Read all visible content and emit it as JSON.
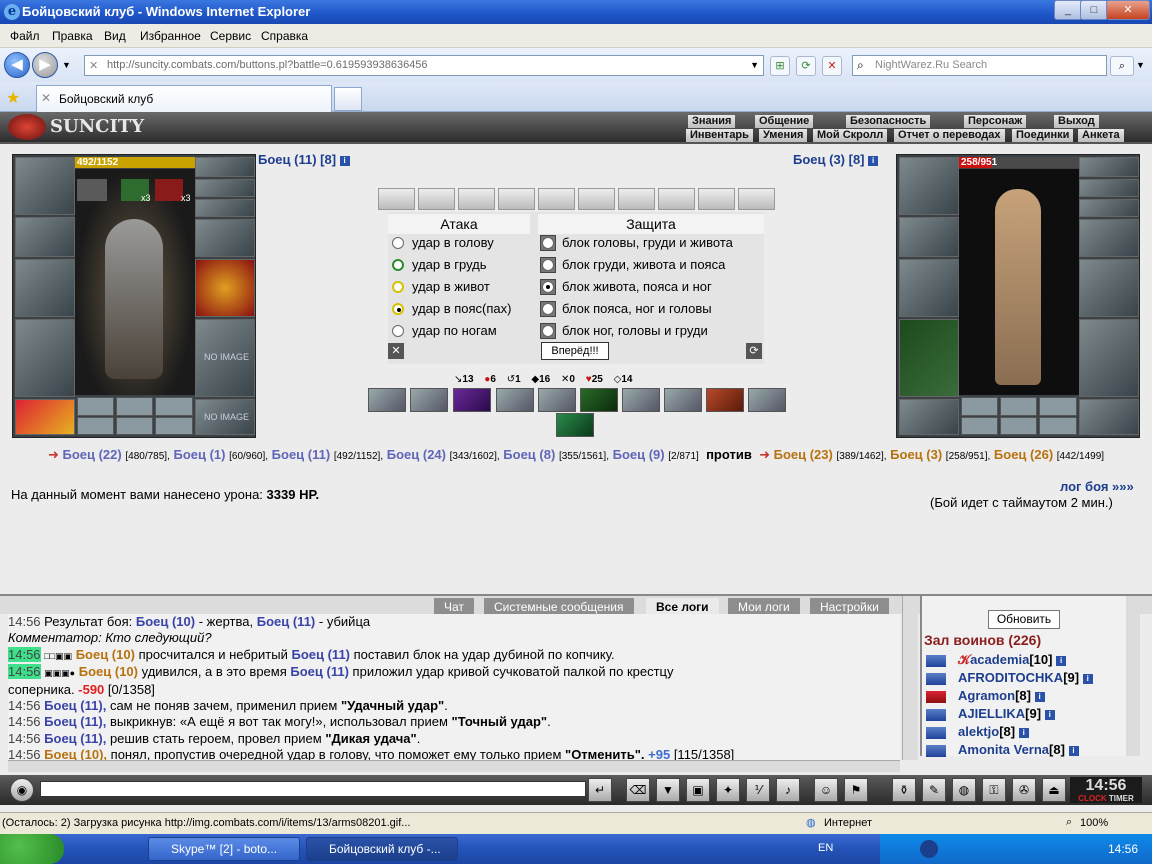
{
  "window": {
    "title": "Бойцовский клуб - Windows Internet Explorer"
  },
  "menu": [
    "Файл",
    "Правка",
    "Вид",
    "Избранное",
    "Сервис",
    "Справка"
  ],
  "address": {
    "url": "http://suncity.combats.com/buttons.pl?battle=0.619593938636456"
  },
  "search": {
    "placeholder": "NightWarez.Ru Search"
  },
  "tab": {
    "label": "Бойцовский клуб"
  },
  "game_nav": {
    "top": [
      "Знания",
      "Общение",
      "Безопасность",
      "Персонаж",
      "Выход"
    ],
    "bottom": [
      "Инвентарь",
      "Умения",
      "Мой Скролл",
      "Отчет о переводах",
      "Поединки",
      "Анкета"
    ]
  },
  "logo": "SUNCITY",
  "left_fighter": {
    "name": "Боец (11) [8]",
    "hp": "492/1152",
    "noimage1": "NO IMAGE",
    "noimage2": "NO IMAGE",
    "x3a": "x3",
    "x3b": "x3"
  },
  "right_fighter": {
    "name": "Боец (3) [8]",
    "hp": "258/951"
  },
  "attack": {
    "title": "Атака",
    "options": [
      "удар в голову",
      "удар в грудь",
      "удар в живот",
      "удар в пояс(пах)",
      "удар по ногам"
    ],
    "selected": 3
  },
  "defense": {
    "title": "Защита",
    "options": [
      "блок головы, груди и живота",
      "блок груди, живота и пояса",
      "блок живота, пояса и ног",
      "блок пояса, ног и головы",
      "блок ног, головы и груди"
    ],
    "selected": 2
  },
  "go_button": "Вперёд!!!",
  "stats": [
    "13",
    "6",
    "1",
    "16",
    "0",
    "25",
    "14"
  ],
  "teams": {
    "t1": [
      "Боец (22)",
      "Боец (1)",
      "Боец (11)",
      "Боец (24)",
      "Боец (8)",
      "Боец (9)"
    ],
    "t1hp": [
      "[480/785],",
      "[60/960],",
      "[492/1152],",
      "[343/1602],",
      "[355/1561],",
      "[2/871]"
    ],
    "vs": "против",
    "t2": [
      "Боец (23)",
      "Боец (3)",
      "Боец (26)"
    ],
    "t2hp": [
      "[389/1462],",
      "[258/951],",
      "[442/1499]"
    ]
  },
  "damage": {
    "label": "На данный момент вами нанесено урона:",
    "value": "3339 HP."
  },
  "battle_log_link": "лог боя »»»",
  "timeout": "(Бой идет с таймаутом 2 мин.)",
  "chat_tabs": [
    "Чат",
    "Системные сообщения",
    "Все логи",
    "Мои логи",
    "Настройки"
  ],
  "refresh": "Обновить",
  "hall": "Зал воинов (226)",
  "users": [
    {
      "name": "academia",
      "level": "[10]"
    },
    {
      "name": "AFRODITOCHKA",
      "level": "[9]"
    },
    {
      "name": "Agramon",
      "level": "[8]"
    },
    {
      "name": "AJIELLIKA",
      "level": "[9]"
    },
    {
      "name": "alektjo",
      "level": "[8]"
    },
    {
      "name": "Amonita Verna",
      "level": "[8]"
    }
  ],
  "log": {
    "l1": {
      "t": "14:56",
      "a": "Результат боя:",
      "p1": "Боец (10)",
      "b": "- жертва,",
      "p2": "Боец (11)",
      "c": "- убийца"
    },
    "l2": "Комментатор: Кто следующий?",
    "l3": {
      "t": "14:56",
      "p1": "Боец (10)",
      "a": "просчитался и небритый",
      "p2": "Боец (11)",
      "b": "поставил блок на удар дубиной по копчику."
    },
    "l4": {
      "t": "14:56",
      "p1": "Боец (10)",
      "a": "удивился, а в это время",
      "p2": "Боец (11)",
      "b": "приложил удар кривой сучковатой палкой по крестцу"
    },
    "l5": {
      "a": "соперника.",
      "dmg": "-590",
      "hp": "[0/1358]"
    },
    "l6": {
      "t": "14:56",
      "p": "Боец (11),",
      "a": "сам не поняв зачем, применил прием",
      "q": "\"Удачный удар\""
    },
    "l7": {
      "t": "14:56",
      "p": "Боец (11),",
      "a": "выкрикнув: «А ещё я вот так могу!», использовал прием",
      "q": "\"Точный удар\""
    },
    "l8": {
      "t": "14:56",
      "p": "Боец (11),",
      "a": "решив стать героем, провел прием",
      "q": "\"Дикая удача\""
    },
    "l9": {
      "t": "14:56",
      "p": "Боец (10),",
      "a": "понял, пропустив очередной удар в голову, что поможет ему только прием",
      "q": "\"Отменить\".",
      "plus": "+95",
      "hp": "[115/1358]"
    }
  },
  "clock": {
    "time": "14:56",
    "clock": "CLOCK",
    "timer": "TIMER"
  },
  "status": {
    "text": "(Осталось: 2) Загрузка рисунка http://img.combats.com/i/items/13/arms08201.gif...",
    "zone": "Интернет",
    "zoom": "100%"
  },
  "taskbar": {
    "t1": "Skype™ [2] - boto...",
    "t2": "Бойцовский клуб -...",
    "lang": "EN",
    "time": "14:56"
  }
}
